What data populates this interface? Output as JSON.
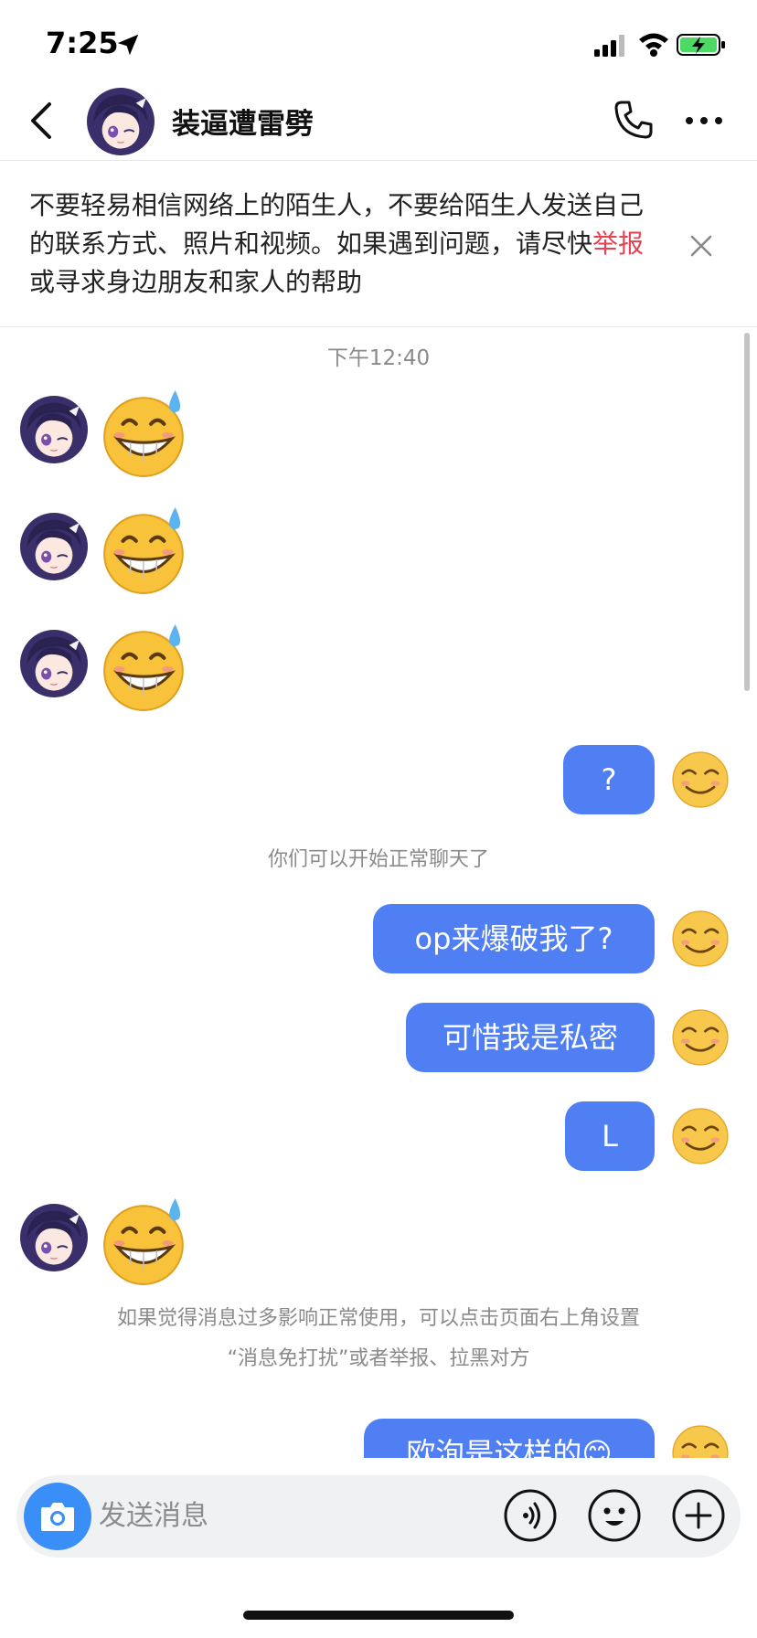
{
  "status_bar": {
    "time": "7:25"
  },
  "header": {
    "contact_name": "装逼遭雷劈"
  },
  "warning": {
    "text_before": "不要轻易相信网络上的陌生人，不要给陌生人发送自己的联系方式、照片和视频。如果遇到问题，请尽快",
    "report_link": "举报",
    "text_after": "或寻求身边朋友和家人的帮助"
  },
  "chat": {
    "timestamp": "下午12:40",
    "system_notice_1": "你们可以开始正常聊天了",
    "system_notice_2_line1": "如果觉得消息过多影响正常使用，可以点击页面右上角设置",
    "system_notice_2_line2": "“消息免打扰”或者举报、拉黑对方",
    "sent_messages": [
      "?",
      "op来爆破我了?",
      "可惜我是私密",
      "L",
      "欧洵是这样的😊"
    ]
  },
  "input": {
    "placeholder": "发送消息"
  },
  "colors": {
    "bubble": "#4f7ff2",
    "report_link": "#e8414f",
    "camera": "#3a8ef7"
  }
}
